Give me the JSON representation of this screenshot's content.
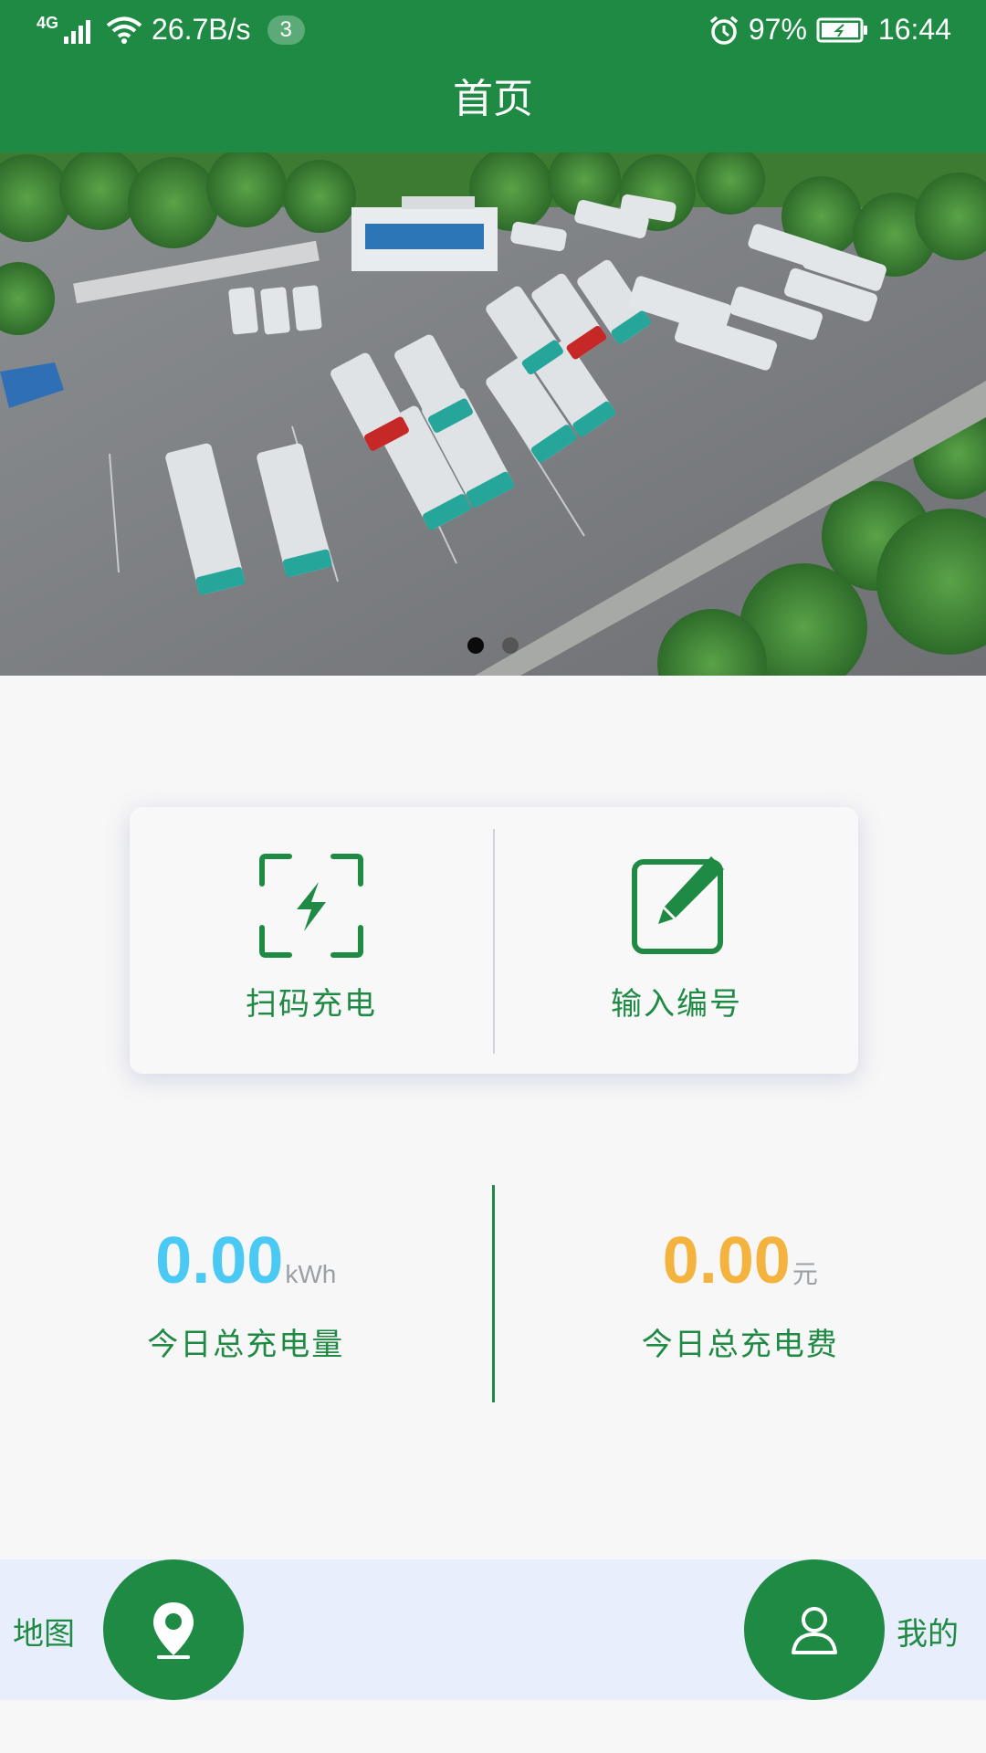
{
  "status_bar": {
    "network": "4G",
    "speed": "26.7B/s",
    "badge": "3",
    "battery": "97%",
    "time": "16:44",
    "icons": [
      "signal-icon",
      "wifi-icon",
      "alarm-icon",
      "battery-icon"
    ]
  },
  "header": {
    "title": "首页"
  },
  "banner": {
    "slides": 2,
    "active_slide": 1
  },
  "actions": {
    "scan": {
      "label": "扫码充电",
      "icon": "scan-charge-icon"
    },
    "input": {
      "label": "输入编号",
      "icon": "edit-icon"
    }
  },
  "stats": {
    "energy": {
      "value": "0.00",
      "unit": "kWh",
      "caption": "今日总充电量",
      "color": "#49c9f4"
    },
    "cost": {
      "value": "0.00",
      "unit": "元",
      "caption": "今日总充电费",
      "color": "#f4b23e"
    }
  },
  "bottom_nav": {
    "map": {
      "label": "地图",
      "icon": "location-pin-icon"
    },
    "mine": {
      "label": "我的",
      "icon": "user-icon"
    }
  },
  "colors": {
    "primary": "#1e8a43",
    "background": "#f7f7f7"
  }
}
